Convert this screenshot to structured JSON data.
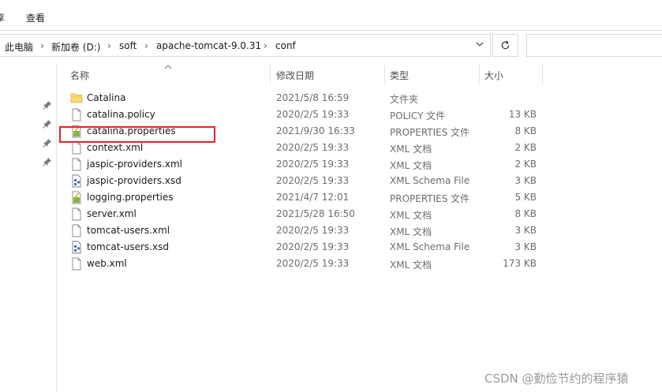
{
  "ribbon": {
    "tab_share_partial": "享",
    "tab_view": "查看"
  },
  "address": {
    "crumbs": [
      "此电脑",
      "新加卷 (D:)",
      "soft",
      "apache-tomcat-9.0.31",
      "conf"
    ],
    "separator": "›"
  },
  "columns": {
    "name": "名称",
    "modified": "修改日期",
    "type": "类型",
    "size": "大小"
  },
  "files": [
    {
      "name": "Catalina",
      "date": "2021/5/8 16:59",
      "type": "文件夹",
      "size": "",
      "icon": "folder-icon"
    },
    {
      "name": "catalina.policy",
      "date": "2020/2/5 19:33",
      "type": "POLICY 文件",
      "size": "13 KB",
      "icon": "file-icon"
    },
    {
      "name": "catalina.properties",
      "date": "2021/9/30 16:33",
      "type": "PROPERTIES 文件",
      "size": "8 KB",
      "icon": "properties-file-icon"
    },
    {
      "name": "context.xml",
      "date": "2020/2/5 19:33",
      "type": "XML 文档",
      "size": "2 KB",
      "icon": "file-icon"
    },
    {
      "name": "jaspic-providers.xml",
      "date": "2020/2/5 19:33",
      "type": "XML 文档",
      "size": "2 KB",
      "icon": "file-icon"
    },
    {
      "name": "jaspic-providers.xsd",
      "date": "2020/2/5 19:33",
      "type": "XML Schema File",
      "size": "3 KB",
      "icon": "xsd-file-icon"
    },
    {
      "name": "logging.properties",
      "date": "2021/4/7 12:01",
      "type": "PROPERTIES 文件",
      "size": "5 KB",
      "icon": "properties-file-icon"
    },
    {
      "name": "server.xml",
      "date": "2021/5/28 16:50",
      "type": "XML 文档",
      "size": "8 KB",
      "icon": "file-icon"
    },
    {
      "name": "tomcat-users.xml",
      "date": "2020/2/5 19:33",
      "type": "XML 文档",
      "size": "3 KB",
      "icon": "file-icon"
    },
    {
      "name": "tomcat-users.xsd",
      "date": "2020/2/5 19:33",
      "type": "XML Schema File",
      "size": "3 KB",
      "icon": "xsd-file-icon"
    },
    {
      "name": "web.xml",
      "date": "2020/2/5 19:33",
      "type": "XML 文档",
      "size": "173 KB",
      "icon": "file-icon"
    }
  ],
  "annotation_color": "#e0242b",
  "watermark": "CSDN @勤俭节约的程序猿"
}
